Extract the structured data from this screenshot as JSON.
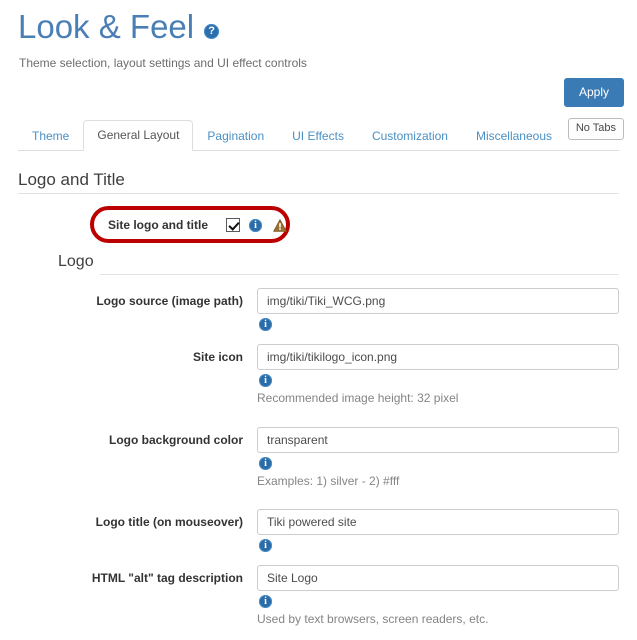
{
  "header": {
    "title": "Look & Feel",
    "help_icon": "help-circle-icon",
    "subtitle": "Theme selection, layout settings and UI effect controls",
    "title_color": "#4a7fb5"
  },
  "toolbar": {
    "apply_label": "Apply",
    "apply_color": "#3a7ab5",
    "no_tabs_label": "No Tabs"
  },
  "tabs": [
    {
      "label": "Theme",
      "active": false
    },
    {
      "label": "General Layout",
      "active": true
    },
    {
      "label": "Pagination",
      "active": false
    },
    {
      "label": "UI Effects",
      "active": false
    },
    {
      "label": "Customization",
      "active": false
    },
    {
      "label": "Miscellaneous",
      "active": false
    }
  ],
  "sections": {
    "logo_and_title": {
      "heading": "Logo and Title",
      "checkbox": {
        "label": "Site logo and title",
        "checked": true,
        "info_icon": "info-icon",
        "warning_icon": "warning-triangle-icon",
        "highlight_color": "#bb0000"
      }
    },
    "logo": {
      "heading": "Logo"
    }
  },
  "fields": [
    {
      "label": "Logo source (image path)",
      "value": "img/tiki/Tiki_WCG.png",
      "placeholder": "",
      "info_icon": "info-icon",
      "helper": ""
    },
    {
      "label": "Site icon",
      "value": "img/tiki/tikilogo_icon.png",
      "placeholder": "",
      "info_icon": "info-icon",
      "helper": "Recommended image height: 32 pixel"
    },
    {
      "label": "Logo background color",
      "value": "transparent",
      "placeholder": "",
      "info_icon": "info-icon",
      "helper": "Examples: 1) silver - 2) #fff"
    },
    {
      "label": "Logo title (on mouseover)",
      "value": "Tiki powered site",
      "placeholder": "",
      "info_icon": "info-icon",
      "helper": ""
    },
    {
      "label": "HTML \"alt\" tag description",
      "value": "Site Logo",
      "placeholder": "",
      "info_icon": "info-icon",
      "helper": "Used by text browsers, screen readers, etc."
    }
  ]
}
